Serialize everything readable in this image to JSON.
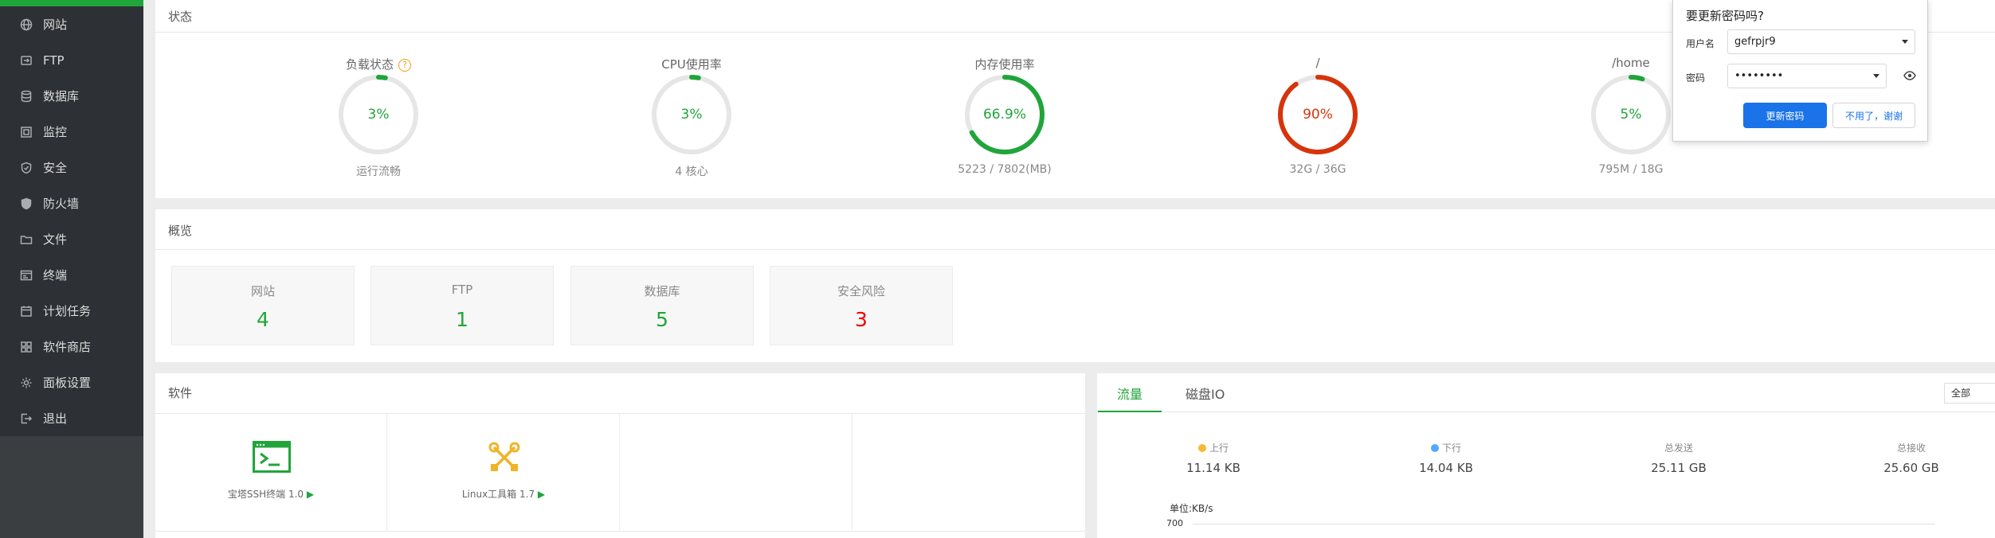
{
  "sidebar": {
    "items": [
      {
        "label": "网站",
        "icon": "globe-icon"
      },
      {
        "label": "FTP",
        "icon": "ftp-icon"
      },
      {
        "label": "数据库",
        "icon": "database-icon"
      },
      {
        "label": "监控",
        "icon": "monitor-icon"
      },
      {
        "label": "安全",
        "icon": "shield-icon"
      },
      {
        "label": "防火墙",
        "icon": "firewall-icon"
      },
      {
        "label": "文件",
        "icon": "folder-icon"
      },
      {
        "label": "终端",
        "icon": "terminal-icon"
      },
      {
        "label": "计划任务",
        "icon": "calendar-icon"
      },
      {
        "label": "软件商店",
        "icon": "grid-icon"
      },
      {
        "label": "面板设置",
        "icon": "gear-icon"
      },
      {
        "label": "退出",
        "icon": "logout-icon"
      }
    ]
  },
  "status": {
    "title": "状态",
    "gauges": [
      {
        "label": "负载状态",
        "value": "3%",
        "percent": 3,
        "sub": "运行流畅",
        "color": "#20a53a"
      },
      {
        "label": "CPU使用率",
        "value": "3%",
        "percent": 3,
        "sub": "4 核心",
        "color": "#20a53a"
      },
      {
        "label": "内存使用率",
        "value": "66.9%",
        "percent": 66.9,
        "sub": "5223 / 7802(MB)",
        "color": "#20a53a"
      },
      {
        "label": "/",
        "value": "90%",
        "percent": 90,
        "sub": "32G / 36G",
        "color": "#d6340c"
      },
      {
        "label": "/home",
        "value": "5%",
        "percent": 5,
        "sub": "795M / 18G",
        "color": "#20a53a"
      }
    ]
  },
  "overview": {
    "title": "概览",
    "cards": [
      {
        "label": "网站",
        "value": "4",
        "color": "#20a53a"
      },
      {
        "label": "FTP",
        "value": "1",
        "color": "#20a53a"
      },
      {
        "label": "数据库",
        "value": "5",
        "color": "#20a53a"
      },
      {
        "label": "安全风险",
        "value": "3",
        "color": "#ee0000"
      }
    ]
  },
  "software": {
    "title": "软件",
    "items": [
      {
        "name": "宝塔SSH终端 1.0",
        "icon": "ssh-terminal-icon"
      },
      {
        "name": "Linux工具箱 1.7",
        "icon": "toolbox-icon"
      }
    ],
    "play": "▶"
  },
  "traffic": {
    "tabs": [
      "流量",
      "磁盘IO"
    ],
    "select_value": "全部",
    "stats": [
      {
        "label": "上行",
        "value": "11.14 KB",
        "dot": "#f7b731"
      },
      {
        "label": "下行",
        "value": "14.04 KB",
        "dot": "#52a9ff"
      },
      {
        "label": "总发送",
        "value": "25.11 GB"
      },
      {
        "label": "总接收",
        "value": "25.60 GB"
      }
    ],
    "unit": "单位:KB/s",
    "y_tick": "700"
  },
  "popup": {
    "title": "要更新密码吗?",
    "username_label": "用户名",
    "username_value": "gefrpjr9",
    "password_label": "密码",
    "password_value": "••••••••",
    "update_button": "更新密码",
    "decline_button": "不用了，谢谢"
  }
}
